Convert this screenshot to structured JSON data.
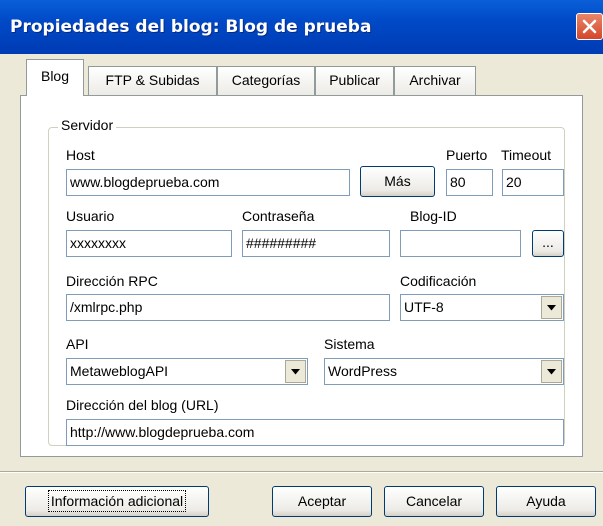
{
  "window": {
    "title": "Propiedades del blog: Blog de prueba"
  },
  "tabs": [
    {
      "label": "Blog",
      "active": true
    },
    {
      "label": "FTP & Subidas",
      "active": false
    },
    {
      "label": "Categorías",
      "active": false
    },
    {
      "label": "Publicar",
      "active": false
    },
    {
      "label": "Archivar",
      "active": false
    }
  ],
  "servidor": {
    "legend": "Servidor",
    "host": {
      "label": "Host",
      "value": "www.blogdeprueba.com"
    },
    "mas_button": "Más",
    "puerto": {
      "label": "Puerto",
      "value": "80"
    },
    "timeout": {
      "label": "Timeout",
      "value": "20"
    },
    "usuario": {
      "label": "Usuario",
      "value": "xxxxxxxx"
    },
    "contrasena": {
      "label": "Contraseña",
      "value": "#########"
    },
    "blogid": {
      "label": "Blog-ID",
      "value": ""
    },
    "browse_button": "...",
    "rpc": {
      "label": "Dirección RPC",
      "value": "/xmlrpc.php"
    },
    "codificacion": {
      "label": "Codificación",
      "value": "UTF-8"
    },
    "api": {
      "label": "API",
      "value": "MetaweblogAPI"
    },
    "sistema": {
      "label": "Sistema",
      "value": "WordPress"
    },
    "url": {
      "label": "Dirección del blog (URL)",
      "value": "http://www.blogdeprueba.com"
    }
  },
  "buttons": {
    "info": "Información adicional",
    "aceptar": "Aceptar",
    "cancelar": "Cancelar",
    "ayuda": "Ayuda"
  },
  "colors": {
    "titlebar": "#0049c6",
    "close": "#d4462a",
    "dialog_bg": "#ece9d8"
  }
}
